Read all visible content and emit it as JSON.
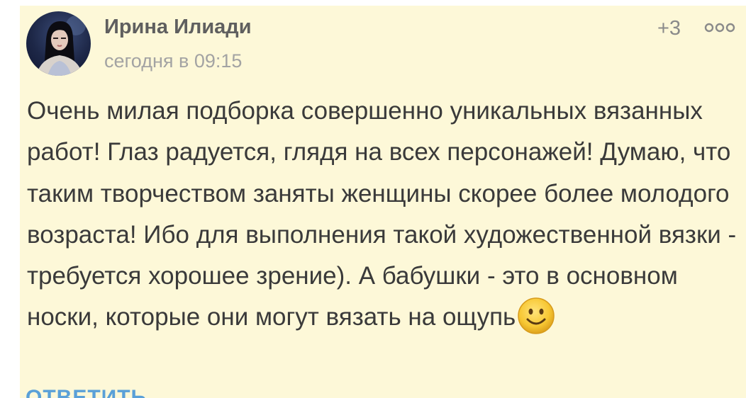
{
  "comment": {
    "author": {
      "name": "Ирина Илиади",
      "avatar_icon": "user-avatar"
    },
    "timestamp": "сегодня в 09:15",
    "likes": "+3",
    "more_icon": "three-dots-icon",
    "text": "Очень милая подборка совершенно уникальных вязанных работ! Глаз радуется, глядя на всех персонажей! Думаю, что таким творчеством заняты женщины скорее более молодого возраста! Ибо для выполнения такой художественной вязки - требуется хорошее зрение). А бабушки - это в основном носки, которые они могут вязать на ощупь",
    "emoji_icon": "smiley-face-icon",
    "reply_label": "ответить"
  },
  "colors": {
    "card_background": "#fdf8d8",
    "text": "#3a3a3a",
    "author": "#5f5f5f",
    "meta": "#a3a3a3",
    "link": "#5aa0d8"
  }
}
